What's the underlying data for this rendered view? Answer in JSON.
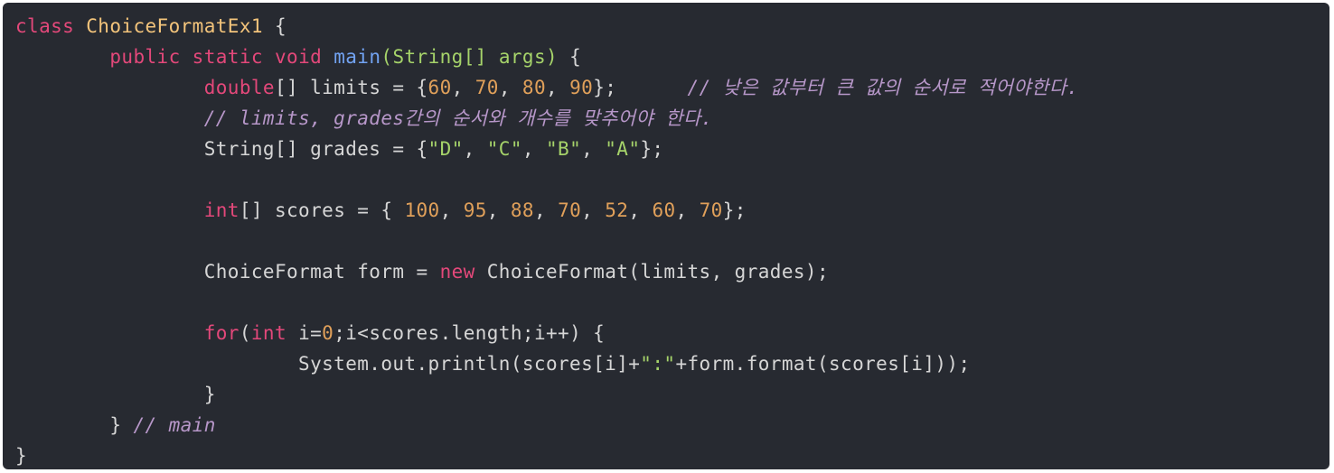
{
  "colors": {
    "background": "#272a31",
    "keyword": "#e3487a",
    "class_name": "#f3c47b",
    "function": "#72a3f2",
    "params": "#a6d36a",
    "number": "#e0a05a",
    "string": "#a6d36a",
    "comment": "#b797c9",
    "plain": "#d6d6d6"
  },
  "lines": [
    [
      {
        "t": "class",
        "k": "kw"
      },
      {
        "t": " ",
        "k": "plain"
      },
      {
        "t": "ChoiceFormatEx1",
        "k": "class"
      },
      {
        "t": " {",
        "k": "plain"
      }
    ],
    [
      {
        "t": "        ",
        "k": "plain"
      },
      {
        "t": "public",
        "k": "kw"
      },
      {
        "t": " ",
        "k": "plain"
      },
      {
        "t": "static",
        "k": "kw"
      },
      {
        "t": " ",
        "k": "plain"
      },
      {
        "t": "void",
        "k": "kw"
      },
      {
        "t": " ",
        "k": "plain"
      },
      {
        "t": "main",
        "k": "fn"
      },
      {
        "t": "(String[] args)",
        "k": "param"
      },
      {
        "t": " {",
        "k": "plain"
      }
    ],
    [
      {
        "t": "                ",
        "k": "plain"
      },
      {
        "t": "double",
        "k": "kw"
      },
      {
        "t": "[] limits = {",
        "k": "plain"
      },
      {
        "t": "60",
        "k": "num"
      },
      {
        "t": ", ",
        "k": "plain"
      },
      {
        "t": "70",
        "k": "num"
      },
      {
        "t": ", ",
        "k": "plain"
      },
      {
        "t": "80",
        "k": "num"
      },
      {
        "t": ", ",
        "k": "plain"
      },
      {
        "t": "90",
        "k": "num"
      },
      {
        "t": "};      ",
        "k": "plain"
      },
      {
        "t": "// 낮은 값부터 큰 값의 순서로 적어야한다.",
        "k": "comment"
      }
    ],
    [
      {
        "t": "                ",
        "k": "plain"
      },
      {
        "t": "// limits, grades간의 순서와 개수를 맞추어야 한다.",
        "k": "comment"
      }
    ],
    [
      {
        "t": "                ",
        "k": "plain"
      },
      {
        "t": "String[] grades = {",
        "k": "plain"
      },
      {
        "t": "\"D\"",
        "k": "str"
      },
      {
        "t": ", ",
        "k": "plain"
      },
      {
        "t": "\"C\"",
        "k": "str"
      },
      {
        "t": ", ",
        "k": "plain"
      },
      {
        "t": "\"B\"",
        "k": "str"
      },
      {
        "t": ", ",
        "k": "plain"
      },
      {
        "t": "\"A\"",
        "k": "str"
      },
      {
        "t": "};",
        "k": "plain"
      }
    ],
    [],
    [
      {
        "t": "                ",
        "k": "plain"
      },
      {
        "t": "int",
        "k": "kw"
      },
      {
        "t": "[] scores = { ",
        "k": "plain"
      },
      {
        "t": "100",
        "k": "num"
      },
      {
        "t": ", ",
        "k": "plain"
      },
      {
        "t": "95",
        "k": "num"
      },
      {
        "t": ", ",
        "k": "plain"
      },
      {
        "t": "88",
        "k": "num"
      },
      {
        "t": ", ",
        "k": "plain"
      },
      {
        "t": "70",
        "k": "num"
      },
      {
        "t": ", ",
        "k": "plain"
      },
      {
        "t": "52",
        "k": "num"
      },
      {
        "t": ", ",
        "k": "plain"
      },
      {
        "t": "60",
        "k": "num"
      },
      {
        "t": ", ",
        "k": "plain"
      },
      {
        "t": "70",
        "k": "num"
      },
      {
        "t": "};",
        "k": "plain"
      }
    ],
    [],
    [
      {
        "t": "                ",
        "k": "plain"
      },
      {
        "t": "ChoiceFormat form = ",
        "k": "plain"
      },
      {
        "t": "new",
        "k": "kw"
      },
      {
        "t": " ChoiceFormat(limits, grades);",
        "k": "plain"
      }
    ],
    [],
    [
      {
        "t": "                ",
        "k": "plain"
      },
      {
        "t": "for",
        "k": "kw"
      },
      {
        "t": "(",
        "k": "plain"
      },
      {
        "t": "int",
        "k": "kw"
      },
      {
        "t": " i=",
        "k": "plain"
      },
      {
        "t": "0",
        "k": "num"
      },
      {
        "t": ";i<scores.length;i++) {",
        "k": "plain"
      }
    ],
    [
      {
        "t": "                        ",
        "k": "plain"
      },
      {
        "t": "System.out.println(scores[i]+",
        "k": "plain"
      },
      {
        "t": "\":\"",
        "k": "str"
      },
      {
        "t": "+form.format(scores[i]));",
        "k": "plain"
      }
    ],
    [
      {
        "t": "                ",
        "k": "plain"
      },
      {
        "t": "}",
        "k": "plain"
      }
    ],
    [
      {
        "t": "        ",
        "k": "plain"
      },
      {
        "t": "} ",
        "k": "plain"
      },
      {
        "t": "// main",
        "k": "comment"
      }
    ],
    [
      {
        "t": "}",
        "k": "plain"
      }
    ]
  ]
}
